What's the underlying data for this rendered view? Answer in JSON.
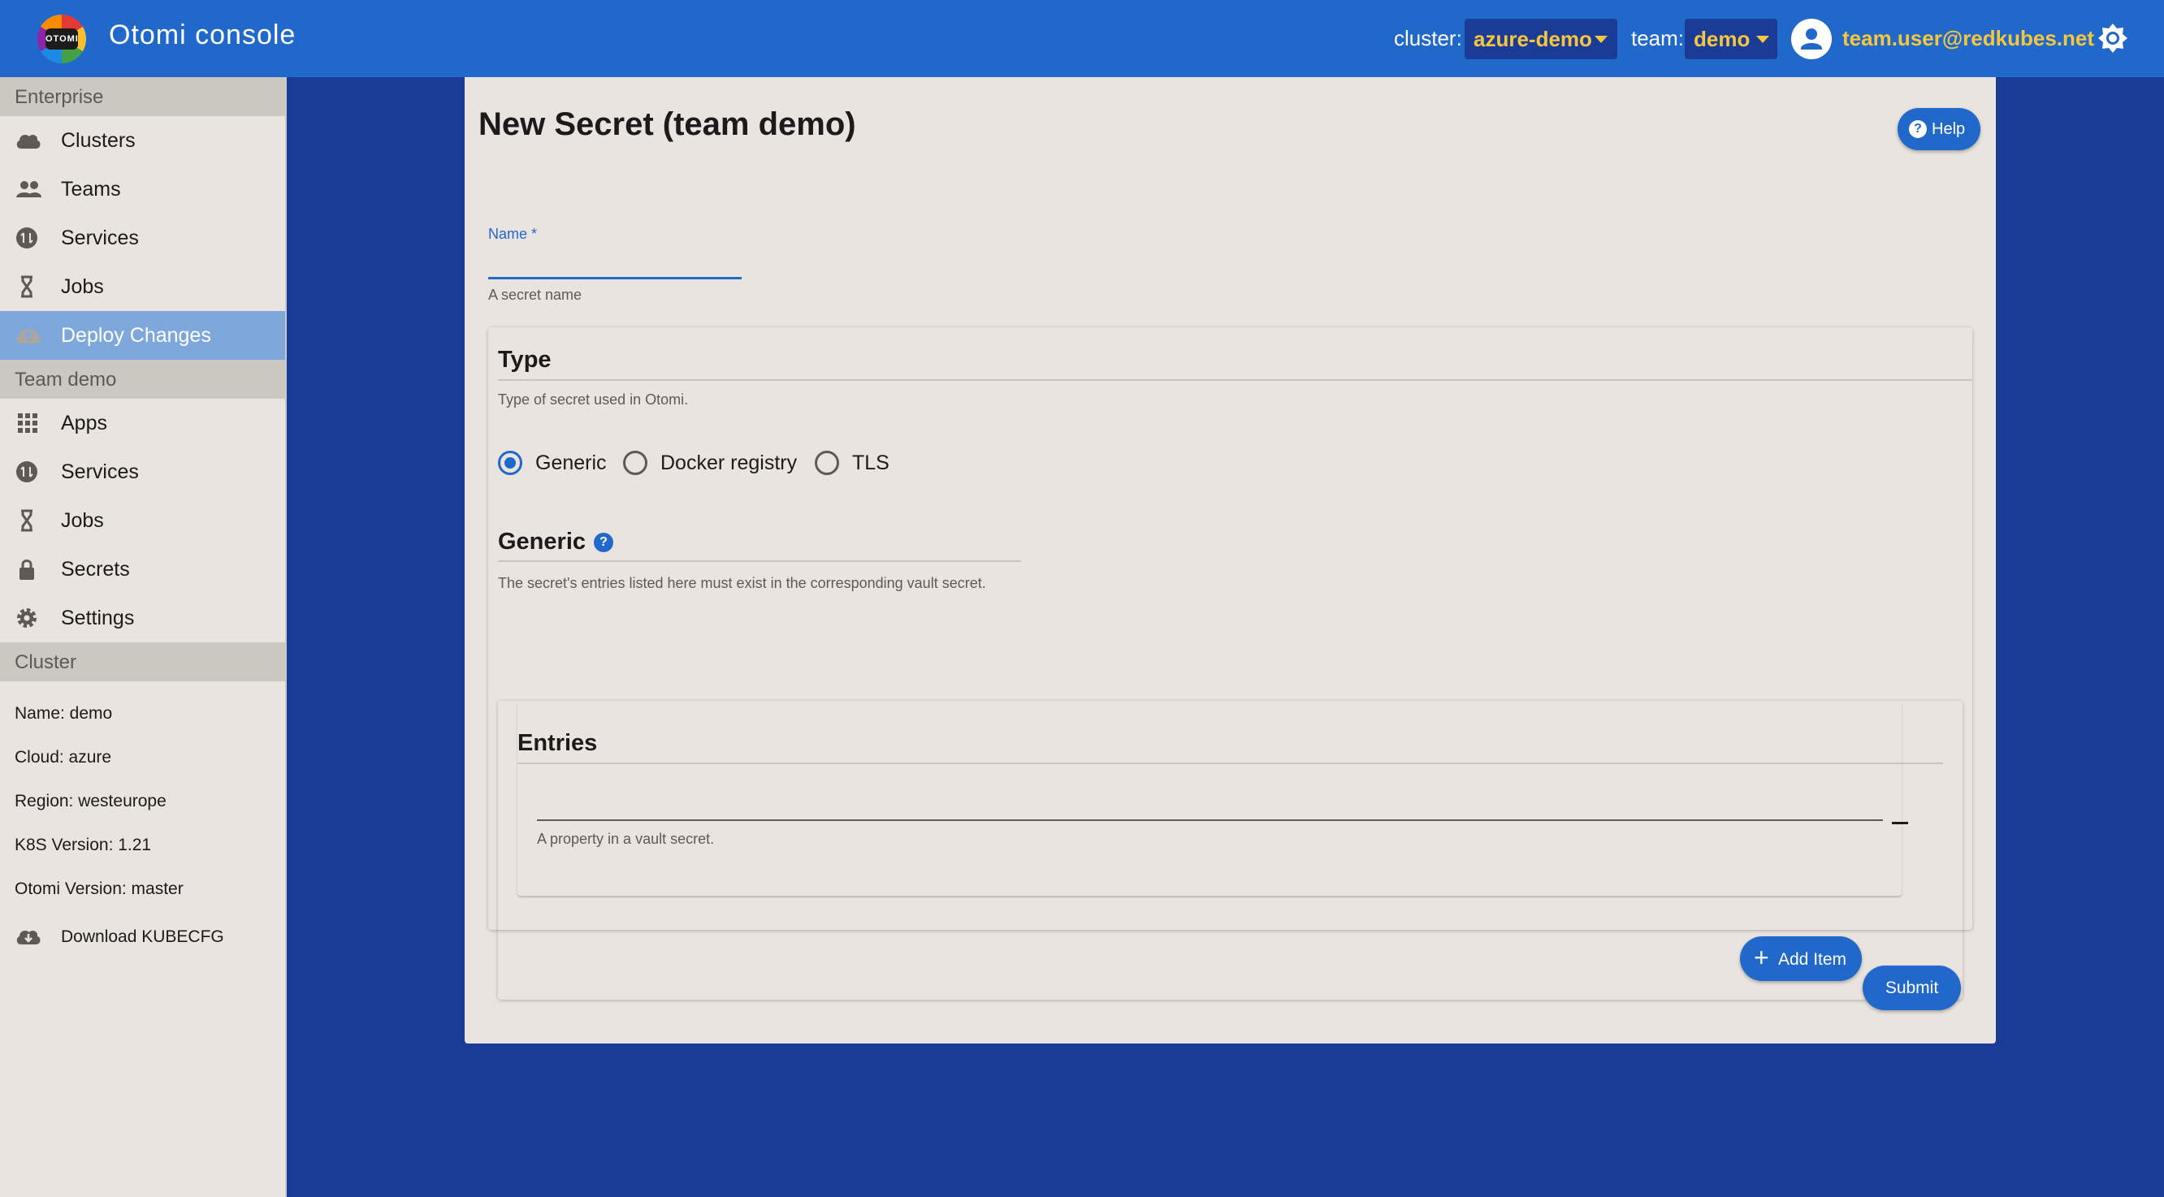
{
  "header": {
    "logo_text": "OTOMI",
    "app_title": "Otomi console",
    "cluster_label": "cluster:",
    "cluster_value": "azure-demo",
    "team_label": "team:",
    "team_value": "demo",
    "user_email": "team.user@redkubes.net"
  },
  "sidebar": {
    "enterprise_header": "Enterprise",
    "enterprise_items": [
      {
        "label": "Clusters",
        "icon": "cloud-icon"
      },
      {
        "label": "Teams",
        "icon": "people-icon"
      },
      {
        "label": "Services",
        "icon": "services-icon"
      },
      {
        "label": "Jobs",
        "icon": "hourglass-icon"
      },
      {
        "label": "Deploy Changes",
        "icon": "cloud-upload-icon"
      }
    ],
    "team_header": "Team demo",
    "team_items": [
      {
        "label": "Apps",
        "icon": "grid-icon"
      },
      {
        "label": "Services",
        "icon": "services-icon"
      },
      {
        "label": "Jobs",
        "icon": "hourglass-icon"
      },
      {
        "label": "Secrets",
        "icon": "lock-icon"
      },
      {
        "label": "Settings",
        "icon": "gear-icon"
      }
    ],
    "cluster_header": "Cluster",
    "cluster_info": [
      "Name: demo",
      "Cloud: azure",
      "Region: westeurope",
      "K8S Version: 1.21",
      "Otomi Version: master"
    ],
    "download_label": "Download KUBECFG"
  },
  "main": {
    "title": "New Secret (team demo)",
    "help_label": "Help",
    "name_label": "Name *",
    "name_value": "",
    "name_helper": "A secret name",
    "type_title": "Type",
    "type_desc": "Type of secret used in Otomi.",
    "type_options": [
      "Generic",
      "Docker registry",
      "TLS"
    ],
    "type_selected": "Generic",
    "generic_title": "Generic",
    "generic_desc": "The secret's entries listed here must exist in the corresponding vault secret.",
    "entries_title": "Entries",
    "entry_value": "",
    "entry_helper": "A property in a vault secret.",
    "add_item_label": "Add Item",
    "submit_label": "Submit"
  },
  "colors": {
    "topbar": "#2069ca",
    "background": "#1a3c96",
    "accent_text": "#f6c63f",
    "panel": "#e9e4df",
    "active_nav": "#7ea8dc"
  }
}
